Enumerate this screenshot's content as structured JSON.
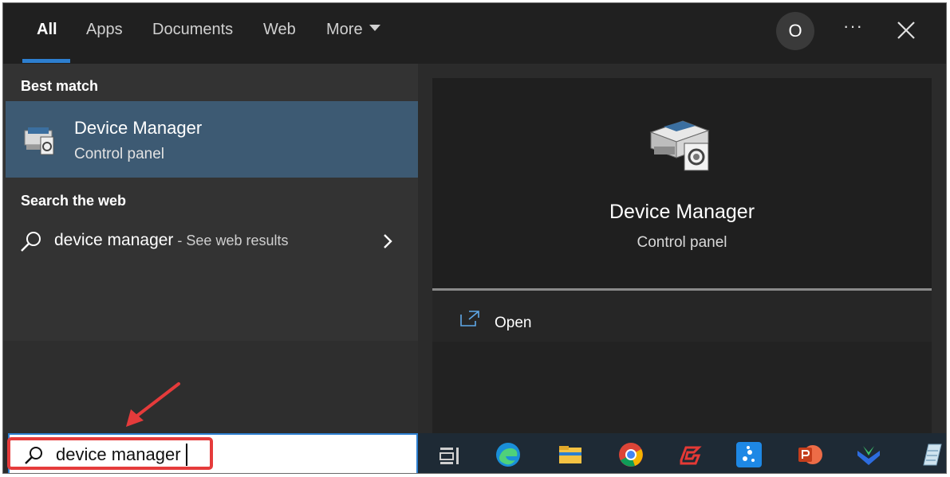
{
  "tabs": [
    {
      "label": "All",
      "active": true
    },
    {
      "label": "Apps"
    },
    {
      "label": "Documents"
    },
    {
      "label": "Web"
    },
    {
      "label": "More"
    }
  ],
  "header": {
    "avatar_initial": "O",
    "more_options": "···"
  },
  "best_match": {
    "heading": "Best match",
    "title": "Device Manager",
    "subtitle": "Control panel"
  },
  "web": {
    "heading": "Search the web",
    "query": "device manager",
    "suffix": " - See web results"
  },
  "preview": {
    "title": "Device Manager",
    "subtitle": "Control panel",
    "open_label": "Open"
  },
  "search": {
    "value": "device manager"
  },
  "taskbar": {
    "icons": [
      "task-view-icon",
      "edge-icon",
      "file-explorer-icon",
      "chrome-icon",
      "red-app-icon",
      "blue-dots-app-icon",
      "powerpoint-icon",
      "green-blue-app-icon",
      "notepad-icon"
    ]
  },
  "colors": {
    "accent": "#2d7fd0",
    "selection": "#3d5a73",
    "annotation": "#e53b3b"
  }
}
